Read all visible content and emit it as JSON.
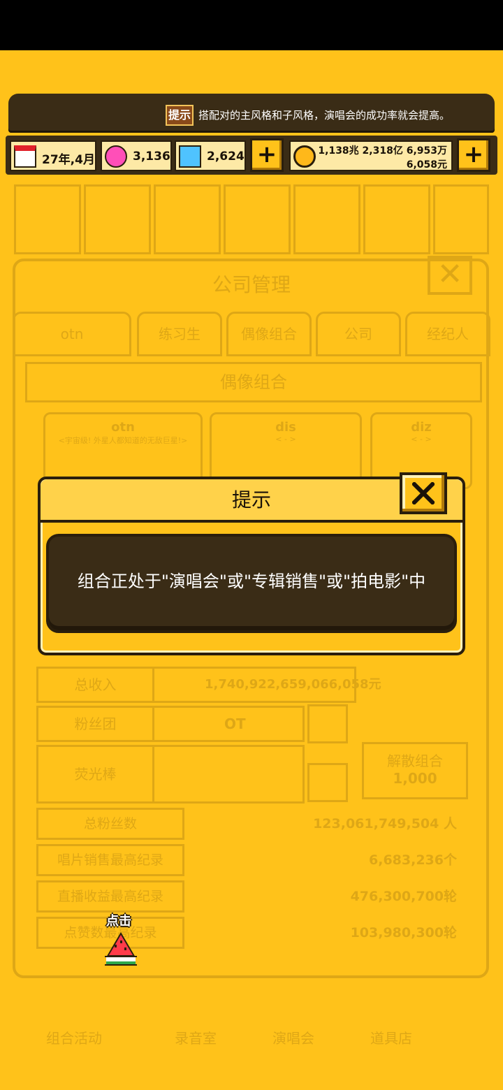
{
  "banner": {
    "tip_label": "提示",
    "message": "搭配对的主风格和子风格，演唱会的成功率就会提高。"
  },
  "resources": {
    "date": "27年,4月",
    "pink_gem": "3,136",
    "blue_gem": "2,624",
    "money_line1": "1,138兆 2,318亿 6,953万",
    "money_line2": "6,058元"
  },
  "background": {
    "panel_title": "公司管理",
    "tabs": [
      "otn",
      "练习生",
      "偶像组合",
      "公司",
      "经纪人"
    ],
    "subtitle": "偶像组合",
    "cards": [
      {
        "name": "otn",
        "desc": "<宇宙级! 外星人都知道的无敌巨星!>"
      },
      {
        "name": "dis",
        "desc": "< - >"
      },
      {
        "name": "diz",
        "desc": "< - >"
      }
    ],
    "rows": [
      {
        "label": "总收入",
        "value": "1,740,922,659,066,058元"
      },
      {
        "label": "粉丝团",
        "value": "OT"
      },
      {
        "label": "荧光棒",
        "value": ""
      }
    ],
    "disband_label": "解散组合",
    "disband_cost": "1,000",
    "stats": [
      {
        "label": "总粉丝数",
        "value": "123,061,749,504 人"
      },
      {
        "label": "唱片销售最高纪录",
        "value": "6,683,236个"
      },
      {
        "label": "直播收益最高纪录",
        "value": "476,300,700轮"
      },
      {
        "label": "点赞数最高纪录",
        "value": "103,980,300轮"
      }
    ],
    "bottom_nav": [
      "组合活动",
      "录音室",
      "演唱会",
      "道具店"
    ]
  },
  "tap_hint": "点击",
  "modal": {
    "title": "提示",
    "message": "组合正处于\"演唱会\"或\"专辑销售\"或\"拍电影\"中"
  }
}
